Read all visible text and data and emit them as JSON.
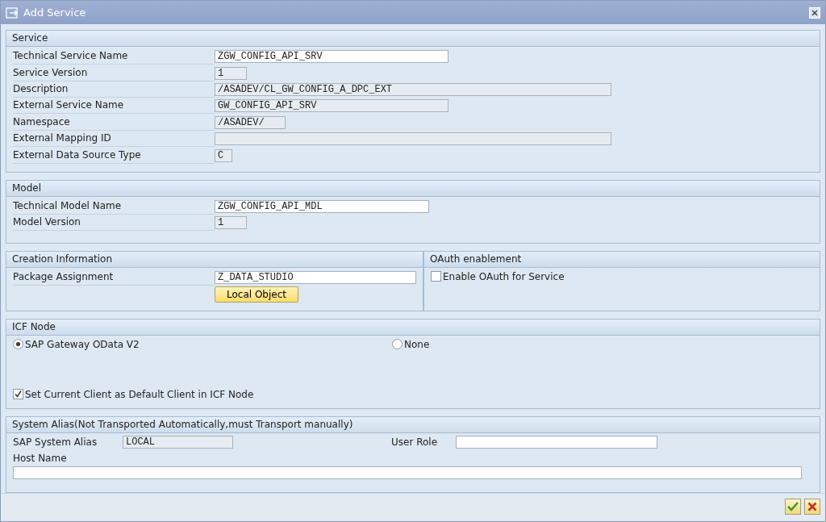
{
  "window": {
    "title": "Add Service"
  },
  "service": {
    "title": "Service",
    "fields": [
      {
        "label": "Technical Service Name",
        "value": "ZGW_CONFIG_API_SRV",
        "disabled": false
      },
      {
        "label": "Service Version",
        "value": "1",
        "disabled": true
      },
      {
        "label": "Description",
        "value": "/ASADEV/CL_GW_CONFIG_A_DPC_EXT",
        "disabled": true
      },
      {
        "label": "External Service Name",
        "value": "GW_CONFIG_API_SRV",
        "disabled": true
      },
      {
        "label": "Namespace",
        "value": "/ASADEV/",
        "disabled": true
      },
      {
        "label": "External Mapping ID",
        "disabled": true
      },
      {
        "label": "External Data Source Type",
        "value": "C",
        "disabled": true
      }
    ]
  },
  "model": {
    "title": "Model",
    "fields": [
      {
        "label": "Technical Model Name",
        "value": "ZGW_CONFIG_API_MDL",
        "disabled": false
      },
      {
        "label": "Model Version",
        "value": "1",
        "disabled": true
      }
    ]
  },
  "creation": {
    "title": "Creation Information",
    "fields": [
      {
        "label": "Package Assignment",
        "value": "Z_DATA_STUDIO",
        "disabled": false
      }
    ],
    "button": "Local Object"
  },
  "oauth": {
    "title": "OAuth enablement",
    "checkbox": {
      "label": "Enable OAuth for Service",
      "checked": false
    }
  },
  "icf": {
    "title": "ICF Node",
    "options": [
      {
        "label": "SAP Gateway OData V2",
        "selected": true
      },
      {
        "label": "None",
        "selected": false
      }
    ],
    "checkbox": {
      "label": "Set Current Client as Default Client in ICF Node",
      "checked": true
    }
  },
  "alias": {
    "title": "System Alias(Not Transported Automatically,must Transport manually)",
    "system_alias": {
      "label": "SAP System Alias",
      "value": "LOCAL",
      "disabled": true
    },
    "user_role": {
      "label": "User Role",
      "disabled": false
    },
    "host_name": {
      "label": "Host Name",
      "disabled": false
    }
  }
}
